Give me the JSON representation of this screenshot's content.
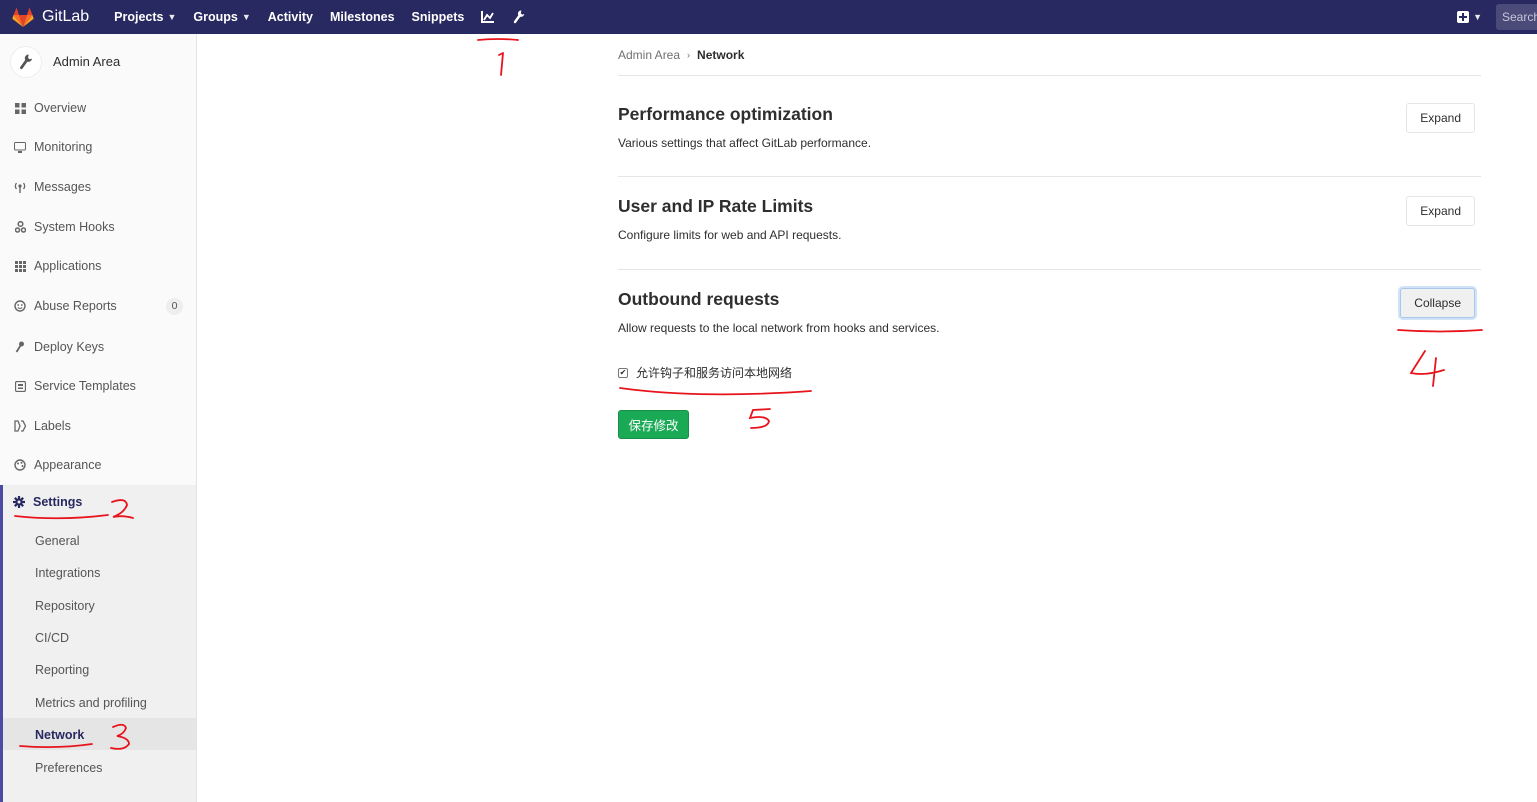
{
  "topbar": {
    "brand": "GitLab",
    "nav": [
      {
        "label": "Projects",
        "dropdown": true
      },
      {
        "label": "Groups",
        "dropdown": true
      },
      {
        "label": "Activity",
        "dropdown": false
      },
      {
        "label": "Milestones",
        "dropdown": false
      },
      {
        "label": "Snippets",
        "dropdown": false
      }
    ],
    "search_placeholder": "Search",
    "icons": [
      "chart-icon",
      "wrench-icon",
      "plus-square-icon",
      "chevron-down-icon"
    ],
    "bg_color": "#292961"
  },
  "sidebar": {
    "title": "Admin Area",
    "items": [
      {
        "label": "Overview",
        "icon": "grid-icon"
      },
      {
        "label": "Monitoring",
        "icon": "monitor-icon"
      },
      {
        "label": "Messages",
        "icon": "broadcast-icon"
      },
      {
        "label": "System Hooks",
        "icon": "hook-icon"
      },
      {
        "label": "Applications",
        "icon": "apps-icon"
      },
      {
        "label": "Abuse Reports",
        "icon": "smiley-icon",
        "badge": "0"
      },
      {
        "label": "Deploy Keys",
        "icon": "key-icon"
      },
      {
        "label": "Service Templates",
        "icon": "template-icon"
      },
      {
        "label": "Labels",
        "icon": "labels-icon"
      },
      {
        "label": "Appearance",
        "icon": "palette-icon"
      }
    ],
    "settings": {
      "label": "Settings",
      "icon": "gear-icon",
      "sub": [
        "General",
        "Integrations",
        "Repository",
        "CI/CD",
        "Reporting",
        "Metrics and profiling",
        "Network",
        "Preferences"
      ],
      "active": "Network"
    }
  },
  "breadcrumb": {
    "parent": "Admin Area",
    "current": "Network"
  },
  "sections": [
    {
      "title": "Performance optimization",
      "desc": "Various settings that affect GitLab performance.",
      "button": "Expand"
    },
    {
      "title": "User and IP Rate Limits",
      "desc": "Configure limits for web and API requests.",
      "button": "Expand"
    },
    {
      "title": "Outbound requests",
      "desc": "Allow requests to the local network from hooks and services.",
      "button": "Collapse",
      "checkbox_label": "允许钩子和服务访问本地网络",
      "checkbox_checked": true,
      "save_label": "保存修改"
    }
  ],
  "annotations": [
    "1",
    "2",
    "3",
    "4",
    "5"
  ],
  "colors": {
    "accent": "#292961",
    "save": "#1aaa55",
    "annotation": "#e8141c"
  }
}
